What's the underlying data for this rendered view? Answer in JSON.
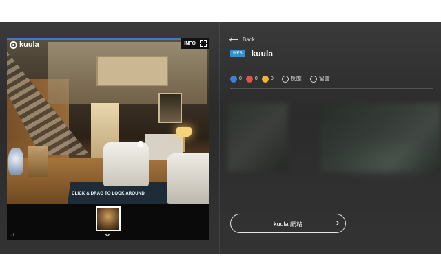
{
  "viewer": {
    "logo_text": "kuula",
    "info_label": "INFO",
    "hint": "CLICK & DRAG TO LOOK AROUND",
    "page_count": "1/1"
  },
  "details": {
    "back_label": "Back",
    "badge": "WEB",
    "title": "kuula",
    "reactions": {
      "like_count": "0",
      "heart_count": "0",
      "emoji_count": "0",
      "feedback_label": "反應",
      "comment_label": "留言"
    },
    "site_button_label": "kuula 網站"
  },
  "colors": {
    "badge_blue": "#2b93d6",
    "like": "#3f7fdc",
    "heart": "#e0524f",
    "emoji": "#f2b531"
  }
}
